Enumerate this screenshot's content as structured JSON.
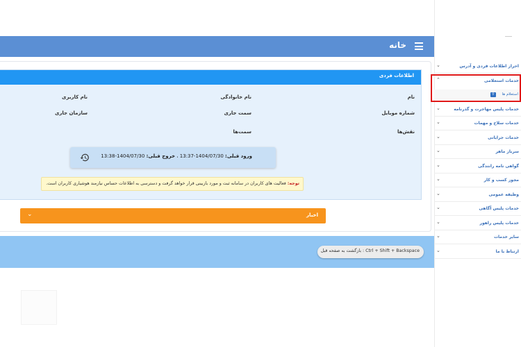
{
  "header": {
    "title": "خانه",
    "menu_icon": "hamburger-menu-icon"
  },
  "personal_info": {
    "title": "اطلاعات فردی",
    "labels": {
      "name": "نام",
      "family": "نام خانوادگی",
      "username": "نام کاربری",
      "mobile": "شماره موبایل",
      "position": "سمت جاری",
      "organization": "سازمان جاری",
      "roles": "نقش‌ها",
      "positions": "سمت‌ها"
    }
  },
  "login_info": {
    "last_login_label": "ورود قبلی:",
    "last_login_value": "1404/07/30-13:37",
    "separator": "،",
    "last_logout_label": "خروج قبلی:",
    "last_logout_value": "1404/07/30-13:38",
    "icon": "history-icon"
  },
  "notice": {
    "label": "توجه:",
    "text": "فعالیت های کاربران در سامانه ثبت و مورد بازبینی قرار خواهد گرفت و دسترسی به اطلاعات حساس نیازمند هوشیاری کاربران است."
  },
  "news": {
    "label": "اخبار"
  },
  "back_hint": "Ctrl + Shift + Backspace : بازگشت به صفحه قبل",
  "sidebar": {
    "items": [
      {
        "label": "احراز اطلاعات فردی و آدرس"
      },
      {
        "label": "خدمات استعلامی"
      },
      {
        "label": "خدمات پلیس مهاجرت و گذرنامه"
      },
      {
        "label": "خدمات سلاح و مهمات"
      },
      {
        "label": "خدمات جرایانی"
      },
      {
        "label": "سرباز ماهر"
      },
      {
        "label": "گواهی نامه رانندگی"
      },
      {
        "label": "مجوز کسب و کار"
      },
      {
        "label": "وظیفه عمومی"
      },
      {
        "label": "خدمات پلیس آگاهی"
      },
      {
        "label": "خدمات پلیس راهور"
      },
      {
        "label": "سایر خدمات"
      },
      {
        "label": "ارتباط با ما"
      }
    ],
    "sub_item": {
      "label": "استعلام ها",
      "icon": "search-icon"
    }
  },
  "colors": {
    "header": "#5b8fd4",
    "info_header": "#2196f3",
    "info_bg": "#e6f1fc",
    "news": "#f7941d",
    "highlight": "#e01818",
    "bottom_band": "#90c5f3"
  }
}
